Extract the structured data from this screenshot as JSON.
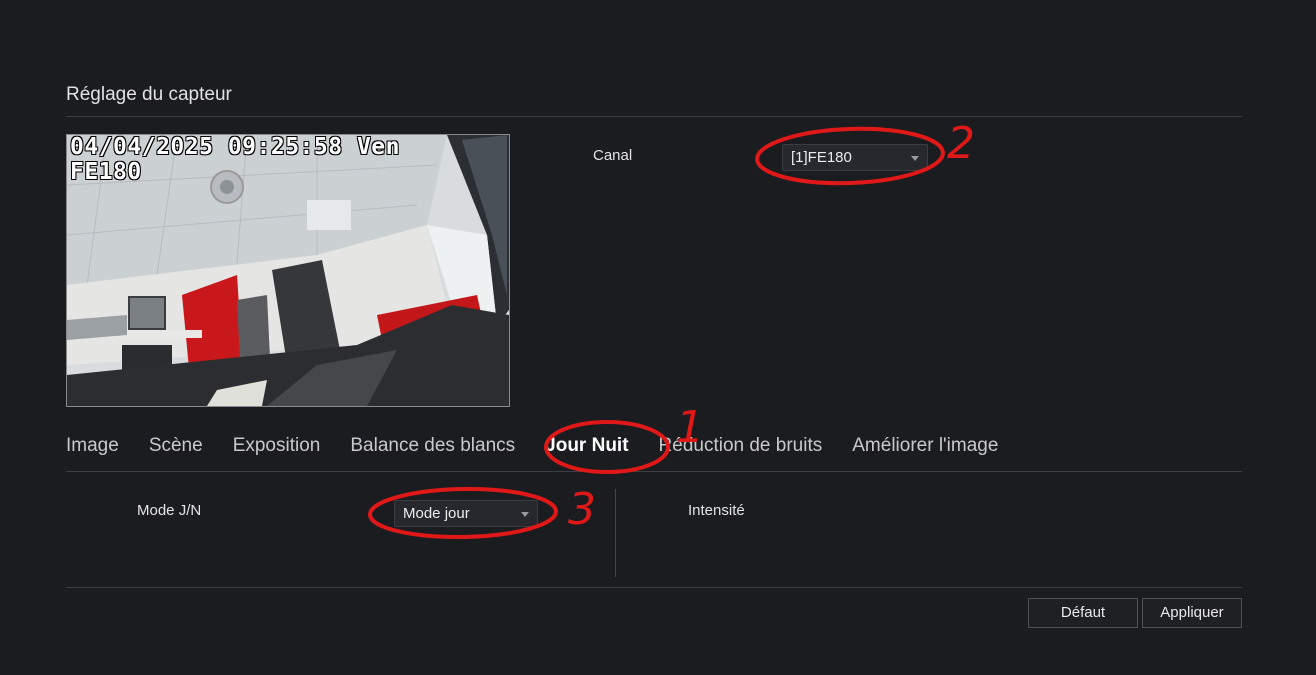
{
  "page": {
    "title": "Réglage du capteur"
  },
  "preview": {
    "osd_datetime": "04/04/2025 09:25:58 Ven",
    "osd_name": "FE180"
  },
  "channel": {
    "label": "Canal",
    "value": "[1]FE180"
  },
  "tabs": [
    {
      "label": "Image",
      "active": false
    },
    {
      "label": "Scène",
      "active": false
    },
    {
      "label": "Exposition",
      "active": false
    },
    {
      "label": "Balance des blancs",
      "active": false
    },
    {
      "label": "Jour Nuit",
      "active": true
    },
    {
      "label": "Réduction de bruits",
      "active": false
    },
    {
      "label": "Améliorer l'image",
      "active": false
    }
  ],
  "daynight": {
    "mode_label": "Mode J/N",
    "mode_value": "Mode jour",
    "intensity_label": "Intensité"
  },
  "actions": {
    "default_label": "Défaut",
    "apply_label": "Appliquer"
  },
  "annotations": {
    "mark_1": "1",
    "mark_2": "2",
    "mark_3": "3",
    "color": "#e01818"
  },
  "colors": {
    "background": "#1b1c20",
    "divider": "#3d3e43"
  }
}
